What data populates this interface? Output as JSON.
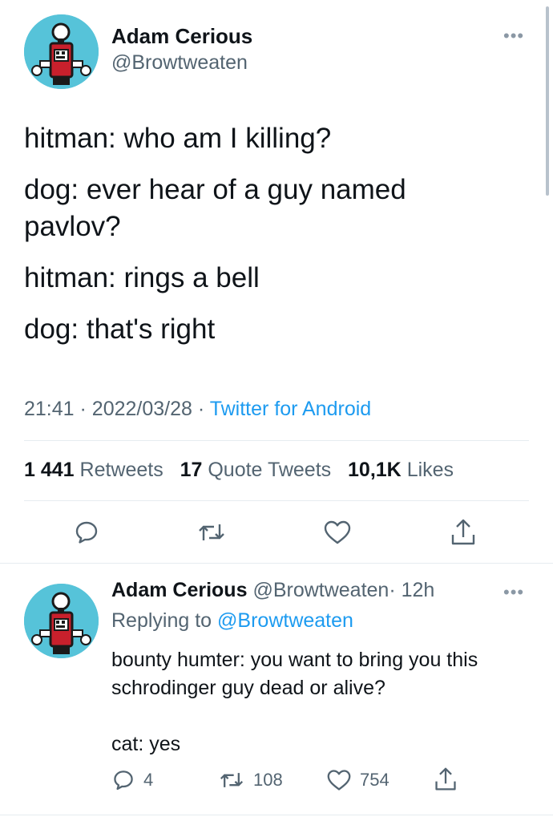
{
  "main_tweet": {
    "author_name": "Adam Cerious",
    "author_handle": "@Browtweaten",
    "lines": [
      "hitman: who am I killing?",
      "dog: ever hear of a guy named pavlov?",
      "hitman: rings a bell",
      "dog: that's right"
    ],
    "time": "21:41",
    "date": "2022/03/28",
    "source": "Twitter for Android",
    "separator": "·",
    "retweets_count": "1 441",
    "retweets_label": "Retweets",
    "quotes_count": "17",
    "quotes_label": "Quote Tweets",
    "likes_count": "10,1K",
    "likes_label": "Likes",
    "icons": [
      "reply-icon",
      "retweet-icon",
      "like-icon",
      "share-icon"
    ]
  },
  "reply_tweet": {
    "author_name": "Adam Cerious",
    "author_handle": "@Browtweaten",
    "time_ago": "· 12h",
    "replying_prefix": "Replying to",
    "replying_handle": "@Browtweaten",
    "text_line_1": "bounty humter: you want to bring you this",
    "text_line_2": "schrodinger guy dead or alive?",
    "text_line_3": "cat: yes",
    "reply_count": "4",
    "retweet_count": "108",
    "like_count": "754"
  },
  "colors": {
    "link": "#1d9bf0",
    "muted": "#536471",
    "avatar_bg": "#56c3d9"
  }
}
